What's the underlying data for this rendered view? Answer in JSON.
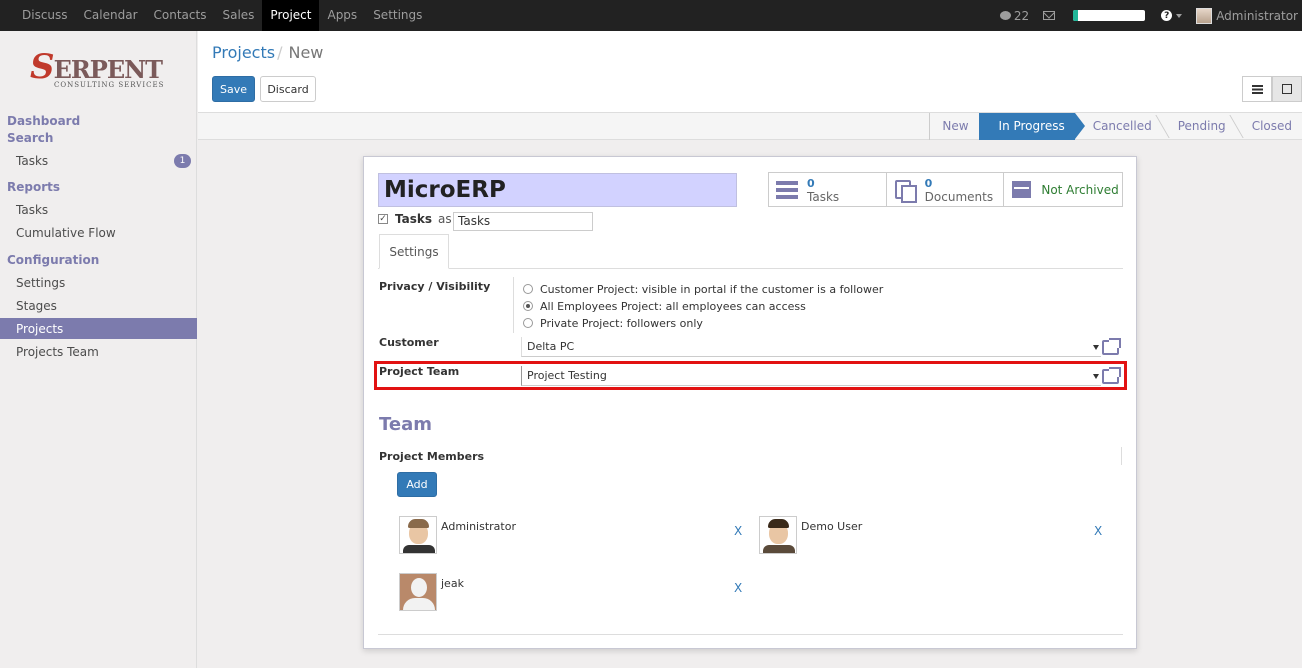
{
  "topbar": {
    "menu": [
      "Discuss",
      "Calendar",
      "Contacts",
      "Sales",
      "Project",
      "Apps",
      "Settings"
    ],
    "active": "Project",
    "chat_count": "22",
    "user": "Administrator",
    "progress": 0.07
  },
  "sidebar": {
    "dashboard": "Dashboard",
    "search": "Search",
    "tasks": "Tasks",
    "tasks_badge": "1",
    "reports": "Reports",
    "reports_tasks": "Tasks",
    "cumulative_flow": "Cumulative Flow",
    "configuration": "Configuration",
    "settings": "Settings",
    "stages": "Stages",
    "projects": "Projects",
    "projects_team": "Projects Team"
  },
  "logo": {
    "big": "S",
    "rest": "ERPENT",
    "small": "CONSULTING SERVICES"
  },
  "breadcrumb": {
    "parent": "Projects",
    "sep": "/",
    "current": "New"
  },
  "buttons": {
    "save": "Save",
    "discard": "Discard",
    "add": "Add"
  },
  "stages": [
    "New",
    "In Progress",
    "Cancelled",
    "Pending",
    "Closed"
  ],
  "current_stage": "In Progress",
  "form": {
    "name": "MicroERP",
    "tasks_checkbox_label": "Tasks",
    "as_label": "as",
    "tasks_alias": "Tasks",
    "smart_buttons": {
      "tasks_count": "0",
      "tasks_label": "Tasks",
      "docs_count": "0",
      "docs_label": "Documents",
      "archive_label": "Not Archived"
    },
    "tab": "Settings",
    "privacy_label": "Privacy / Visibility",
    "privacy_options": [
      "Customer Project: visible in portal if the customer is a follower",
      "All Employees Project: all employees can access",
      "Private Project: followers only"
    ],
    "privacy_selected": 1,
    "customer_label": "Customer",
    "customer_value": "Delta PC",
    "team_label": "Project Team",
    "team_value": "Project Testing",
    "team_section": "Team",
    "members_label": "Project Members",
    "members": [
      {
        "name": "Administrator",
        "remove": "X"
      },
      {
        "name": "Demo User",
        "remove": "X"
      },
      {
        "name": "jeak",
        "remove": "X"
      }
    ]
  },
  "colors": {
    "accent": "#7c7bad",
    "primary": "#337ab7",
    "highlight": "#e21212"
  }
}
